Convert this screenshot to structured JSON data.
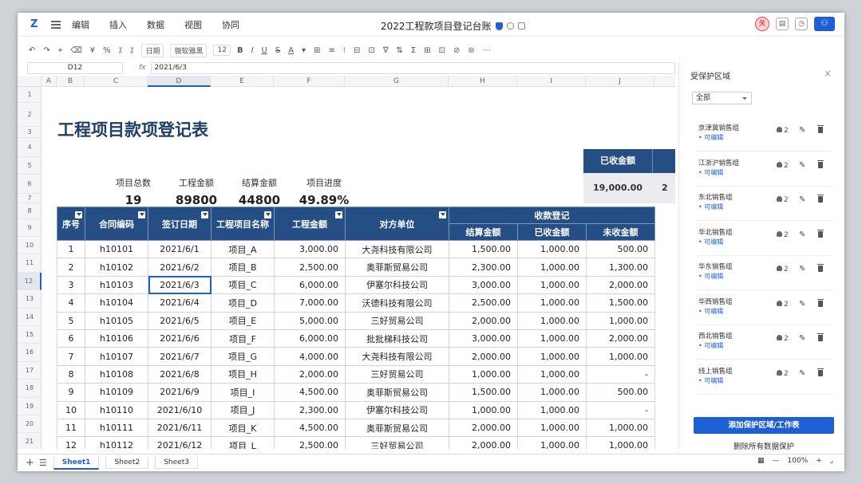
{
  "menubar": {
    "logo": "Z",
    "items": [
      "编辑",
      "插入",
      "数据",
      "视图",
      "协同"
    ],
    "title": "2022工程款项目登记台账",
    "avatar_text": "关"
  },
  "toolbar": {
    "items": [
      "↶",
      "↷",
      "⌖",
      "⌫",
      "¥",
      "%",
      "⁒",
      "⁒"
    ],
    "format": "日期",
    "font": "微软雅黑",
    "size": "12",
    "styles": [
      "B",
      "I",
      "U",
      "S",
      "A",
      "▾",
      "⊞",
      "≡",
      "⁝",
      "⊟",
      "⊡",
      "∇",
      "⇅",
      "Σ",
      "⊞",
      "⊡",
      "⊘",
      "⊜",
      "⋯"
    ]
  },
  "formula": {
    "cell": "D12",
    "fx": "fx",
    "value": "2021/6/3"
  },
  "columns": [
    "A",
    "B",
    "C",
    "D",
    "E",
    "F",
    "G",
    "H",
    "I",
    "J"
  ],
  "rows": [
    "1",
    "2",
    "3",
    "4",
    "5",
    "6",
    "7",
    "8",
    "9",
    "10",
    "11",
    "12",
    "13",
    "14",
    "15",
    "16",
    "17",
    "18",
    "19",
    "20",
    "21"
  ],
  "sheet": {
    "title": "工程项目款项登记表",
    "stats": [
      {
        "label": "项目总数",
        "value": "19"
      },
      {
        "label": "工程金额",
        "value": "89800"
      },
      {
        "label": "结算金额",
        "value": "44800"
      },
      {
        "label": "项目进度",
        "value": "49.89%"
      }
    ],
    "received_label": "已收金额",
    "received_value": "19,000.00",
    "received_next": "2"
  },
  "table": {
    "headers": [
      "序号",
      "合同编码",
      "签订日期",
      "工程项目名称",
      "工程金额",
      "对方单位",
      "收款登记"
    ],
    "subheaders": [
      "结算金额",
      "已收金额",
      "未收金额"
    ],
    "rows": [
      [
        "1",
        "h10101",
        "2021/6/1",
        "项目_A",
        "3,000.00",
        "大尧科技有限公司",
        "1,500.00",
        "1,000.00",
        "500.00"
      ],
      [
        "2",
        "h10102",
        "2021/6/2",
        "项目_B",
        "2,500.00",
        "奥菲斯贸易公司",
        "2,300.00",
        "1,000.00",
        "1,300.00"
      ],
      [
        "3",
        "h10103",
        "2021/6/3",
        "项目_C",
        "6,000.00",
        "伊塞尔科技公司",
        "3,000.00",
        "1,000.00",
        "2,000.00"
      ],
      [
        "4",
        "h10104",
        "2021/6/4",
        "项目_D",
        "7,000.00",
        "沃德科技有限公司",
        "2,500.00",
        "1,000.00",
        "1,500.00"
      ],
      [
        "5",
        "h10105",
        "2021/6/5",
        "项目_E",
        "5,000.00",
        "三好贸易公司",
        "2,000.00",
        "1,000.00",
        "1,000.00"
      ],
      [
        "6",
        "h10106",
        "2021/6/6",
        "项目_F",
        "6,000.00",
        "批批梯科技公司",
        "3,000.00",
        "1,000.00",
        "2,000.00"
      ],
      [
        "7",
        "h10107",
        "2021/6/7",
        "项目_G",
        "4,000.00",
        "大尧科技有限公司",
        "2,000.00",
        "1,000.00",
        "1,000.00"
      ],
      [
        "8",
        "h10108",
        "2021/6/8",
        "项目_H",
        "2,000.00",
        "三好贸易公司",
        "1,000.00",
        "1,000.00",
        "-"
      ],
      [
        "9",
        "h10109",
        "2021/6/9",
        "项目_I",
        "4,500.00",
        "奥菲斯贸易公司",
        "1,500.00",
        "1,000.00",
        "500.00"
      ],
      [
        "10",
        "h10110",
        "2021/6/10",
        "项目_J",
        "2,300.00",
        "伊塞尔科技公司",
        "1,000.00",
        "1,000.00",
        "-"
      ],
      [
        "11",
        "h10111",
        "2021/6/11",
        "项目_K",
        "4,500.00",
        "奥菲斯贸易公司",
        "2,000.00",
        "1,000.00",
        "1,000.00"
      ],
      [
        "12",
        "h10112",
        "2021/6/12",
        "项目_L",
        "2,500.00",
        "三好贸易公司",
        "2,000.00",
        "1,000.00",
        "1,000.00"
      ]
    ]
  },
  "tabs": [
    "Sheet1",
    "Sheet2",
    "Sheet3"
  ],
  "zoom": "100%",
  "panel": {
    "title": "受保护区域",
    "close": "×",
    "filter": "全部",
    "groups": [
      {
        "name": "京津冀销售组",
        "perm": "• 可编辑",
        "users": "2"
      },
      {
        "name": "江浙沪销售组",
        "perm": "• 可编辑",
        "users": "2"
      },
      {
        "name": "东北销售组",
        "perm": "• 可编辑",
        "users": "2"
      },
      {
        "name": "华北销售组",
        "perm": "• 可编辑",
        "users": "2"
      },
      {
        "name": "华东销售组",
        "perm": "• 可编辑",
        "users": "2"
      },
      {
        "name": "华西销售组",
        "perm": "• 可编辑",
        "users": "2"
      },
      {
        "name": "西北销售组",
        "perm": "• 可编辑",
        "users": "2"
      },
      {
        "name": "线上销售组",
        "perm": "• 可编辑",
        "users": "2"
      }
    ],
    "add_label": "添加保护区域/工作表",
    "remove_label": "删除所有数据保护"
  }
}
